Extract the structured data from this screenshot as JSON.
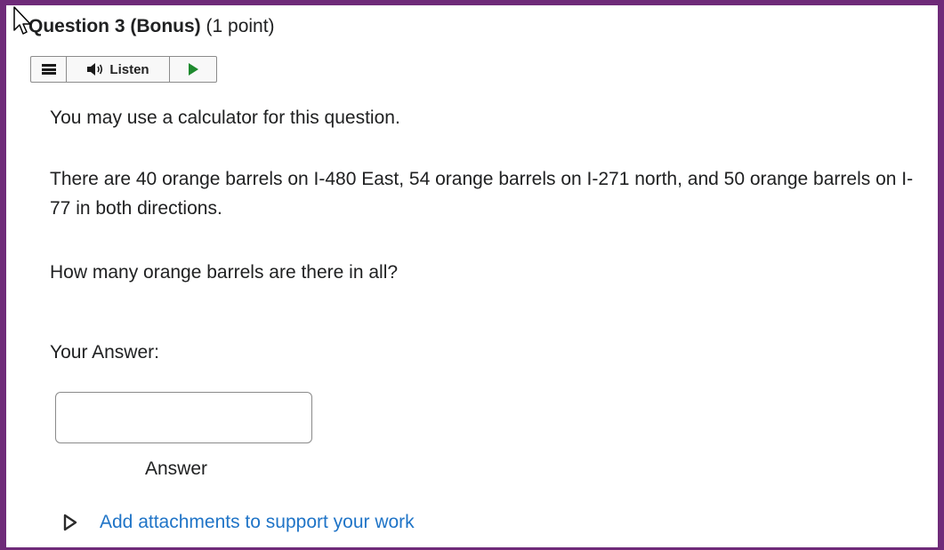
{
  "question": {
    "title_bold": "Question 3 (Bonus)",
    "title_points": "(1 point)"
  },
  "toolbar": {
    "listen_label": "Listen"
  },
  "content": {
    "line1": "You may use a calculator for this question.",
    "line2": "There are 40 orange barrels on I-480 East, 54 orange barrels on I-271 north, and 50 orange barrels on I-77 in both directions.",
    "line3": "How many orange barrels are there in all?"
  },
  "answer": {
    "label": "Your Answer:",
    "value": "",
    "caption": "Answer"
  },
  "attachments": {
    "link_text": "Add attachments to support your work"
  },
  "colors": {
    "frame": "#6f2b79",
    "link": "#1f74c7",
    "play": "#1e8a2e"
  }
}
